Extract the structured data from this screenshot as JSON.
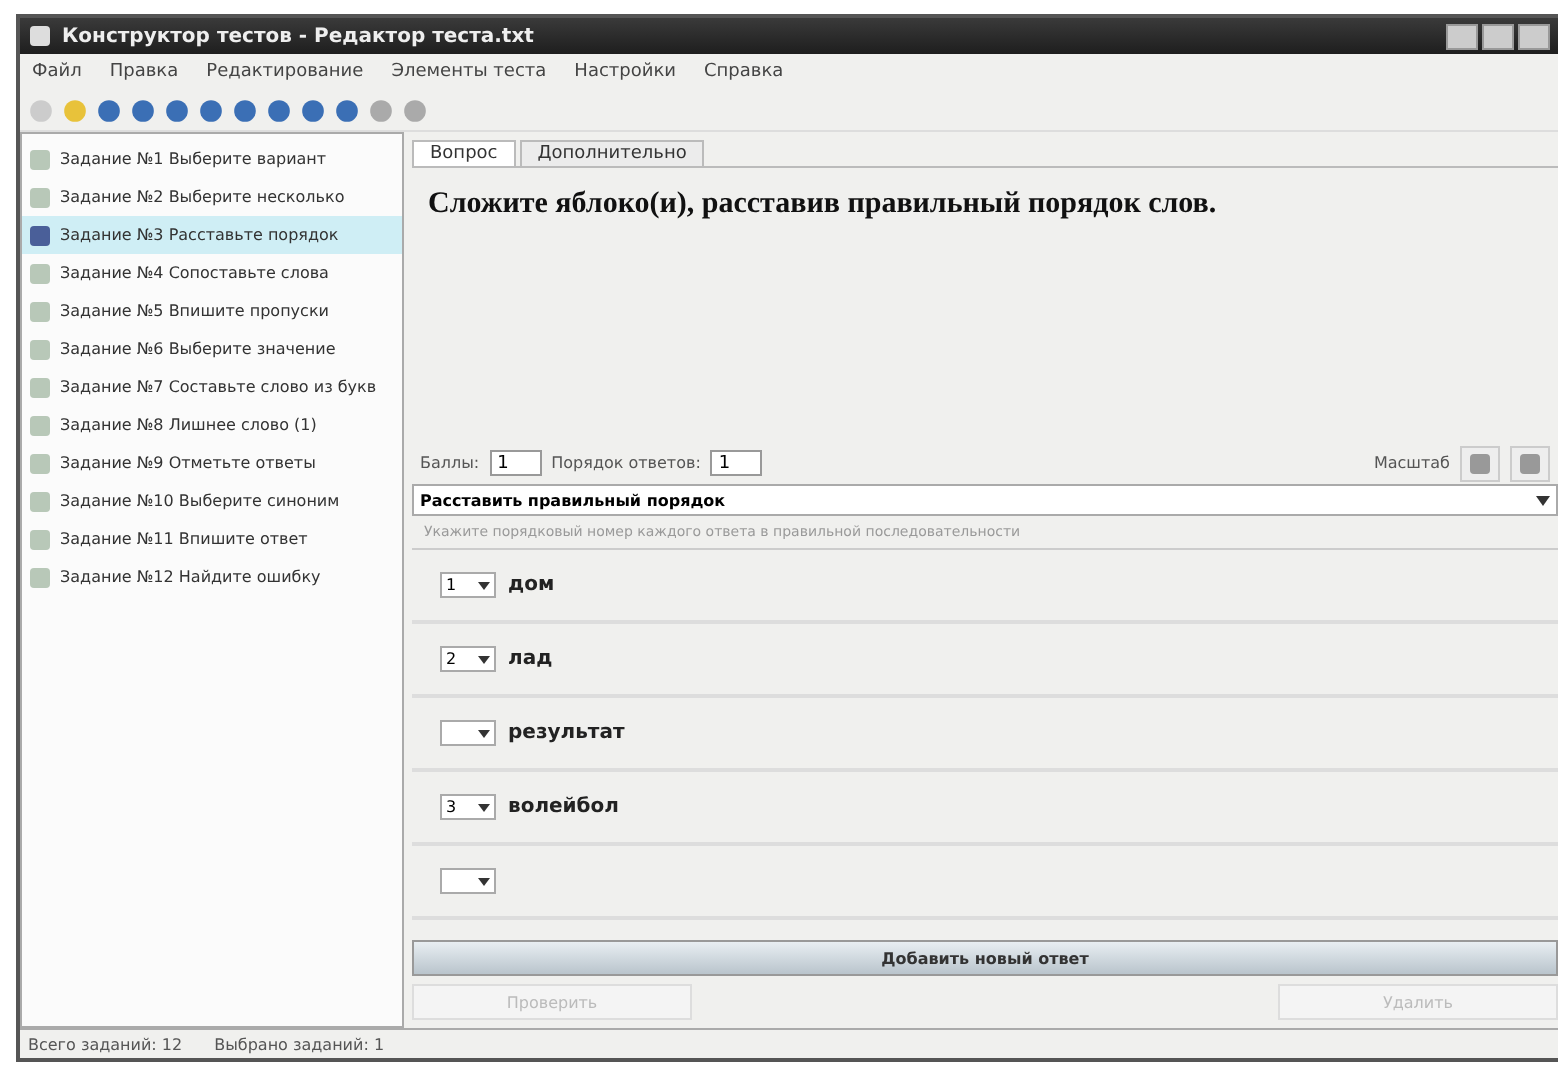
{
  "window": {
    "title": "Конструктор тестов - Редактор теста.txt"
  },
  "menu": [
    "Файл",
    "Правка",
    "Редактирование",
    "Элементы теста",
    "Настройки",
    "Справка"
  ],
  "sidebar": {
    "items": [
      {
        "label": "Задание №1 Выберите вариант",
        "selected": false
      },
      {
        "label": "Задание №2 Выберите несколько",
        "selected": false
      },
      {
        "label": "Задание №3 Расставьте порядок",
        "selected": true
      },
      {
        "label": "Задание №4 Сопоставьте слова",
        "selected": false
      },
      {
        "label": "Задание №5 Впишите пропуски",
        "selected": false
      },
      {
        "label": "Задание №6 Выберите значение",
        "selected": false
      },
      {
        "label": "Задание №7 Составьте слово из букв",
        "selected": false
      },
      {
        "label": "Задание №8 Лишнее слово (1)",
        "selected": false
      },
      {
        "label": "Задание №9 Отметьте ответы",
        "selected": false
      },
      {
        "label": "Задание №10 Выберите синоним",
        "selected": false
      },
      {
        "label": "Задание №11 Впишите ответ",
        "selected": false
      },
      {
        "label": "Задание №12 Найдите ошибку",
        "selected": false
      }
    ]
  },
  "tabs": [
    {
      "label": "Вопрос",
      "selected": true
    },
    {
      "label": "Дополнительно",
      "selected": false
    }
  ],
  "question": "Сложите яблоко(и), расставив правильный порядок слов.",
  "controls": {
    "score_label": "Баллы:",
    "score": "1",
    "order_label": "Порядок ответов:",
    "order": "1",
    "zoom_label": "Масштаб"
  },
  "answer_type": "Расставить правильный порядок",
  "hint": "Укажите порядковый номер каждого ответа в правильной последовательности",
  "answers": [
    {
      "kind": "answer",
      "number": "1",
      "text": "дом"
    },
    {
      "kind": "answer",
      "number": "2",
      "text": "лад"
    },
    {
      "kind": "answer",
      "text": "результат"
    },
    {
      "kind": "answer",
      "number": "3",
      "text": "волейбол"
    },
    {
      "kind": "new"
    }
  ],
  "add_button": "Добавить новый ответ",
  "buttons": [
    {
      "label": "Проверить",
      "disabled": true
    },
    {
      "label": "Удалить",
      "disabled": true
    }
  ],
  "status_bar": [
    "Всего заданий: 12",
    "Выбрано заданий: 1"
  ]
}
